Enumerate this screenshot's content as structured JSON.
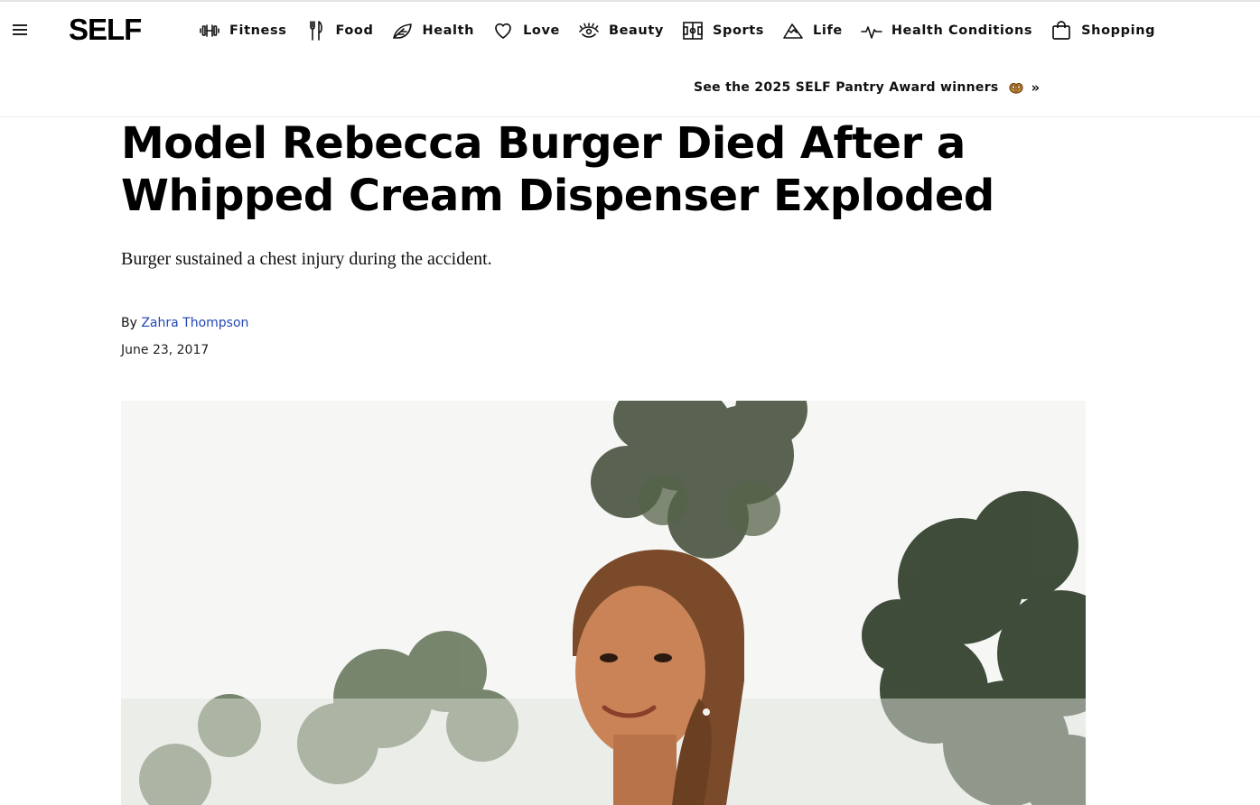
{
  "site": {
    "logo": "SELF",
    "menu_icon": "hamburger-menu-icon"
  },
  "nav": {
    "items": [
      {
        "label": "Fitness",
        "icon": "dumbbell-icon"
      },
      {
        "label": "Food",
        "icon": "fork-knife-icon"
      },
      {
        "label": "Health",
        "icon": "leaf-icon"
      },
      {
        "label": "Love",
        "icon": "heart-icon"
      },
      {
        "label": "Beauty",
        "icon": "eye-lashes-icon"
      },
      {
        "label": "Sports",
        "icon": "court-icon"
      },
      {
        "label": "Life",
        "icon": "mountain-icon"
      },
      {
        "label": "Health Conditions",
        "icon": "heartbeat-icon"
      },
      {
        "label": "Shopping",
        "icon": "shopping-bag-icon"
      }
    ]
  },
  "promo": {
    "text": "See the 2025 SELF Pantry Award winners",
    "emoji": "pretzel-icon",
    "arrow": "»"
  },
  "article": {
    "headline": "Model Rebecca Burger Died After a Whipped Cream Dispenser Exploded",
    "dek": "Burger sustained a chest injury during the accident.",
    "byline_prefix": "By",
    "author": "Zahra Thompson",
    "date": "June 23, 2017"
  },
  "colors": {
    "link": "#2346b4",
    "text": "#000000",
    "divider": "#ececec"
  }
}
